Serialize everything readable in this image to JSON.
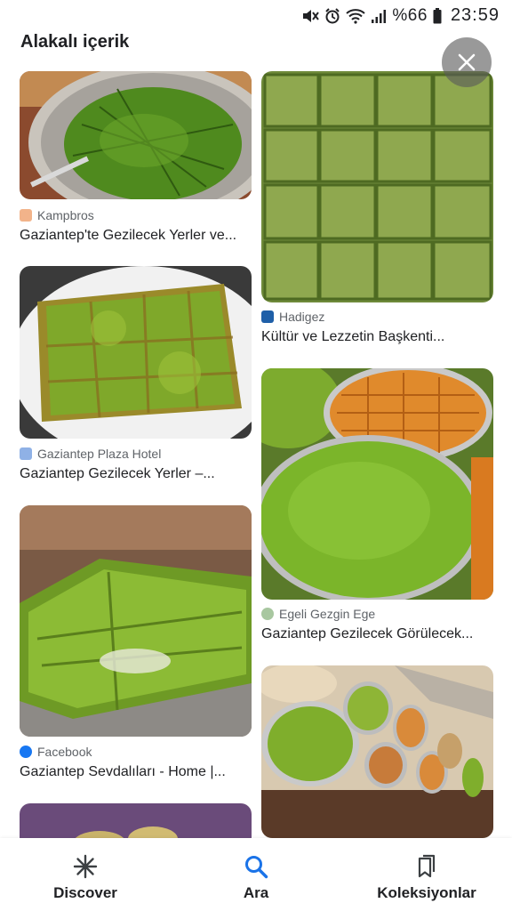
{
  "status_bar": {
    "battery_percent": "%66",
    "time": "23:59"
  },
  "header": {
    "title": "Alakalı içerik"
  },
  "cards_left": [
    {
      "source": "Kampbros",
      "caption": "Gaziantep'te Gezilecek Yerler ve..."
    },
    {
      "source": "Gaziantep Plaza Hotel",
      "caption": "Gaziantep Gezilecek Yerler –..."
    },
    {
      "source": "Facebook",
      "caption": "Gaziantep Sevdalıları - Home |..."
    }
  ],
  "cards_right": [
    {
      "source": "Hadigez",
      "caption": "Kültür ve Lezzetin Başkenti..."
    },
    {
      "source": "Egeli Gezgin Ege",
      "caption": "Gaziantep Gezilecek Görülecek..."
    }
  ],
  "bottom_nav": {
    "items": [
      {
        "label": "Discover",
        "icon": "asterisk-icon"
      },
      {
        "label": "Ara",
        "icon": "search-icon"
      },
      {
        "label": "Koleksiyonlar",
        "icon": "bookmark-icon"
      }
    ]
  },
  "colors": {
    "accent": "#1a73e8",
    "pistachio": "#7fa82a",
    "text": "#202124"
  }
}
